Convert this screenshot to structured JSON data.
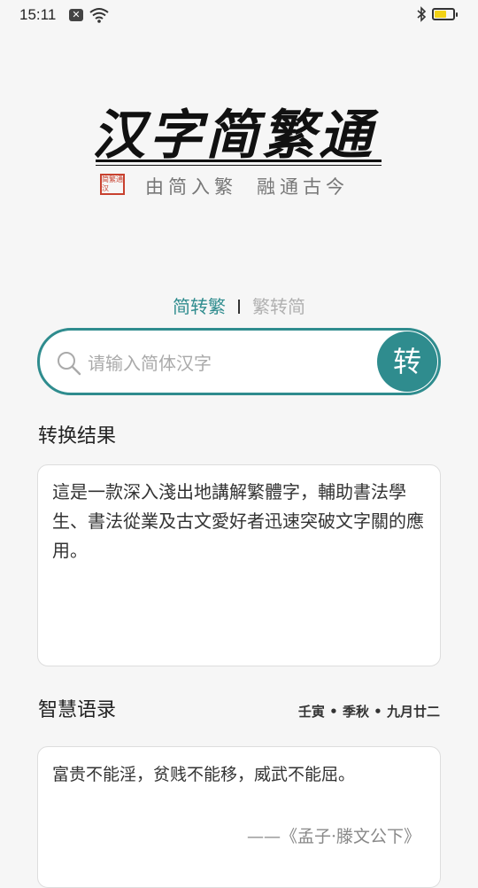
{
  "status_bar": {
    "time": "15:11",
    "notification_glyph": "✕",
    "battery_level": 0.65
  },
  "logo": {
    "title": "汉字简繁通",
    "seal_text": "简繁通汉",
    "subtitle_left": "由简入繁",
    "subtitle_right": "融通古今"
  },
  "tabs": [
    {
      "label": "简转繁",
      "active": true
    },
    {
      "label": "繁转简",
      "active": false
    }
  ],
  "search": {
    "placeholder": "请输入简体汉字",
    "value": "",
    "button_label": "转"
  },
  "result": {
    "title": "转换结果",
    "text": "這是一款深入淺出地講解繁體字，輔助書法學生、書法從業及古文愛好者迅速突破文字關的應用。"
  },
  "quote": {
    "title": "智慧语录",
    "date": "壬寅 • 季秋 • 九月廿二",
    "text": "富贵不能淫，贫贱不能移，威武不能屈。",
    "source": "——《孟子·滕文公下》"
  },
  "colors": {
    "accent": "#2f8c8e",
    "inactive_tab": "#b0b0b0",
    "seal": "#c8412f",
    "battery": "#f2d215"
  }
}
